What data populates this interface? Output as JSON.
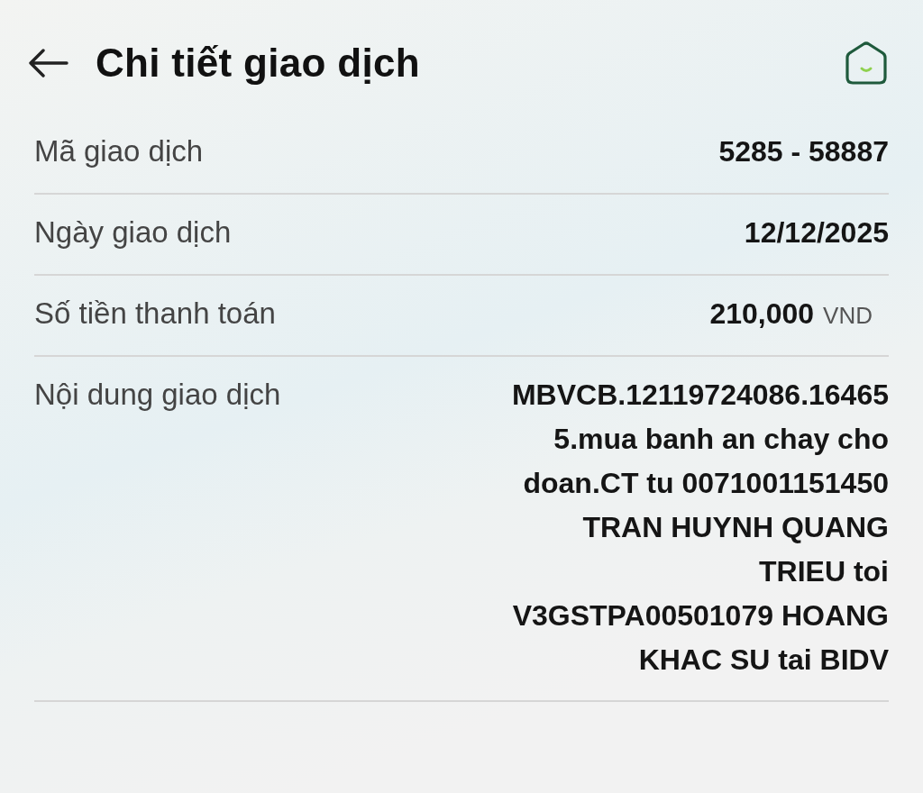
{
  "header": {
    "title": "Chi tiết giao dịch"
  },
  "rows": [
    {
      "kind": "plain",
      "label": "Mã giao dịch",
      "value": "5285 - 58887"
    },
    {
      "kind": "plain",
      "label": "Ngày giao dịch",
      "value": "12/12/2025"
    },
    {
      "kind": "amount",
      "label": "Số tiền thanh toán",
      "value": "210,000",
      "currency": "VND"
    },
    {
      "kind": "multiline",
      "label": "Nội dung giao dịch",
      "value": "MBVCB.12119724086.164655.mua banh an chay cho doan.CT tu 0071001151450 TRAN HUYNH QUANG TRIEU toi V3GSTPA00501079 HOANG KHAC SU tai BIDV"
    }
  ]
}
